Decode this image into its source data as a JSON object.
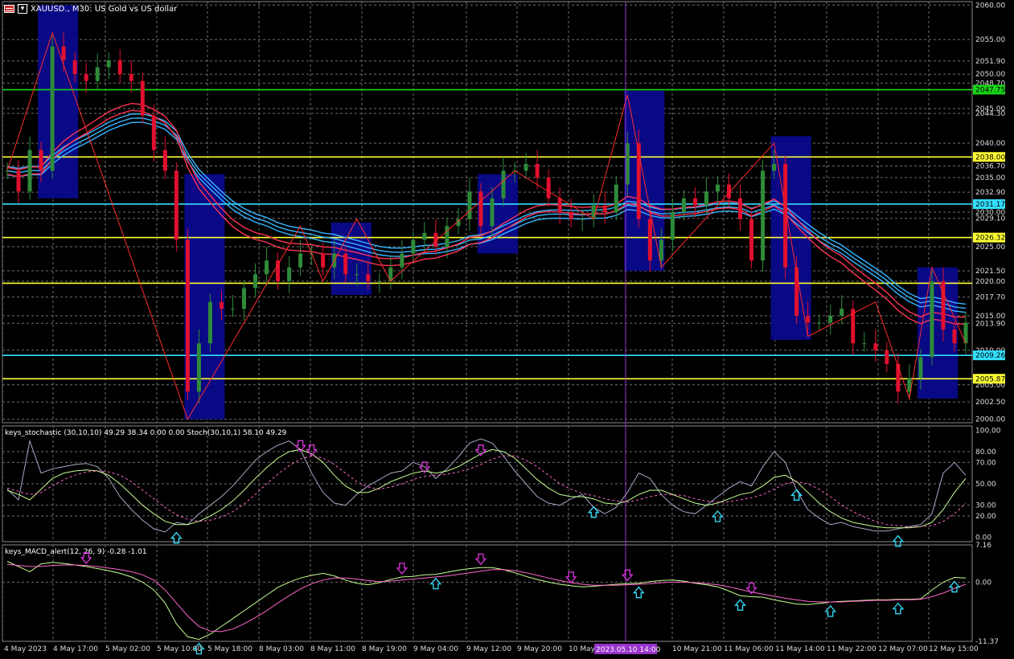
{
  "chart_title": "XAUUSD., M30:  US Gold vs US dollar",
  "colors": {
    "background": "#000000",
    "grid": "#6f6f6f",
    "bull": "#2e8b3a",
    "bear": "#e0102e",
    "zigzag": "#ff2a2a",
    "zone": "#0a0a8c",
    "ribbon_blue": "#37b6ff",
    "ribbon_red": "#ff3355",
    "level_green": "#19d419",
    "level_yellow": "#ffff33",
    "level_cyan": "#33e0ff",
    "cursor": "#9933cc",
    "up_arrow": "#33e0ff",
    "down_arrow": "#dd33dd"
  },
  "chart_data": [
    {
      "type": "candlestick",
      "symbol": "XAUUSD.",
      "timeframe": "M30",
      "description": "US Gold vs US dollar",
      "ylim": [
        1999.5,
        2060.5
      ],
      "y_ticks": [
        "2060.00",
        "2055.00",
        "2051.90",
        "2050.00",
        "2048.70",
        "2045.00",
        "2044.30",
        "2040.00",
        "2038.00",
        "2036.70",
        "2035.00",
        "2032.90",
        "2030.00",
        "2029.10",
        "2025.00",
        "2021.50",
        "2020.00",
        "2017.70",
        "2015.00",
        "2013.90",
        "2010.00",
        "2009.26",
        "2005.00",
        "2002.50",
        "2000.00"
      ],
      "x_ticks": [
        "4 May 2023",
        "4 May 17:00",
        "5 May 02:00",
        "5 May 10:00",
        "5 May 18:00",
        "8 May 03:00",
        "8 May 11:00",
        "8 May 19:00",
        "9 May 04:00",
        "9 May 12:00",
        "9 May 20:00",
        "10 May",
        "10 May 21:00",
        "11 May 06:00",
        "11 May 14:00",
        "11 May 22:00",
        "12 May 07:00",
        "12 May 15:00"
      ],
      "cursor_label": "2023.05.10 14:00",
      "horizontal_levels": [
        {
          "price": 2047.75,
          "label": "2047.75",
          "color": "green"
        },
        {
          "price": 2038.0,
          "label": "2038.00",
          "color": "yellow"
        },
        {
          "price": 2031.17,
          "label": "2031.17",
          "color": "cyan"
        },
        {
          "price": 2026.32,
          "label": "2026.32",
          "color": "yellow"
        },
        {
          "price": 2019.7,
          "label": "",
          "color": "yellow"
        },
        {
          "price": 2009.26,
          "label": "2009.26",
          "color": "cyan"
        },
        {
          "price": 2005.87,
          "label": "2005.87",
          "color": "yellow"
        }
      ],
      "zones": [
        {
          "i0": 3,
          "i1": 6,
          "high": 2060.0,
          "low": 2032.0
        },
        {
          "i0": 16,
          "i1": 19,
          "high": 2035.5,
          "low": 2000.0
        },
        {
          "i0": 29,
          "i1": 32,
          "high": 2028.5,
          "low": 2018.0
        },
        {
          "i0": 42,
          "i1": 45,
          "high": 2035.5,
          "low": 2024.0
        },
        {
          "i0": 55,
          "i1": 58,
          "high": 2047.6,
          "low": 2021.5
        },
        {
          "i0": 68,
          "i1": 71,
          "high": 2041.0,
          "low": 2011.5
        },
        {
          "i0": 81,
          "i1": 84,
          "high": 2022.0,
          "low": 2003.0
        }
      ],
      "closes": [
        2036,
        2033,
        2039,
        2036,
        2054,
        2052,
        2050,
        2049,
        2051,
        2052,
        2050,
        2049,
        2044,
        2039,
        2036,
        2026,
        2004,
        2011,
        2017,
        2016,
        2016,
        2019,
        2021,
        2023,
        2020,
        2022,
        2024,
        2024,
        2022,
        2024,
        2021,
        2021,
        2020,
        2020,
        2022,
        2024,
        2026,
        2027,
        2025,
        2028,
        2029,
        2033,
        2028,
        2032,
        2036,
        2036,
        2037,
        2035,
        2032,
        2030,
        2029,
        2029,
        2031,
        2030,
        2034,
        2040,
        2029,
        2023,
        2026,
        2030,
        2032,
        2031,
        2033,
        2034,
        2032,
        2029,
        2023,
        2036,
        2037,
        2022,
        2015,
        2014,
        2014,
        2015,
        2016,
        2011,
        2011,
        2010,
        2008,
        2004,
        2006,
        2009,
        2020,
        2013,
        2011,
        2014
      ]
    },
    {
      "type": "line",
      "title": "keys_stochastic (30,10,10) 49.29 38.34 0.00 0.00 Stoch(30,10,1) 58.10 49.29",
      "ylim": [
        0,
        100
      ],
      "y_ticks": [
        "100.00",
        "80.00",
        "70.00",
        "50.00",
        "30.00",
        "20.00",
        "0.00"
      ],
      "levels": [
        80,
        70,
        50,
        30,
        20
      ],
      "fast": [
        45,
        35,
        90,
        60,
        64,
        66,
        68,
        69,
        66,
        55,
        38,
        26,
        16,
        8,
        5,
        14,
        12,
        22,
        30,
        38,
        48,
        60,
        72,
        80,
        86,
        90,
        82,
        60,
        42,
        32,
        30,
        40,
        48,
        54,
        60,
        62,
        70,
        66,
        55,
        64,
        75,
        88,
        92,
        88,
        76,
        62,
        50,
        38,
        32,
        30,
        36,
        40,
        28,
        22,
        28,
        42,
        60,
        55,
        40,
        30,
        24,
        22,
        30,
        38,
        46,
        52,
        48,
        66,
        80,
        70,
        44,
        26,
        18,
        12,
        14,
        10,
        8,
        6,
        6,
        8,
        10,
        12,
        22,
        60,
        70,
        58
      ],
      "main": [
        44,
        40,
        35,
        45,
        55,
        60,
        62,
        63,
        62,
        58,
        50,
        40,
        30,
        22,
        15,
        12,
        12,
        15,
        20,
        26,
        34,
        44,
        55,
        65,
        74,
        80,
        82,
        78,
        70,
        58,
        48,
        42,
        42,
        46,
        52,
        56,
        60,
        62,
        60,
        62,
        66,
        72,
        78,
        82,
        80,
        74,
        64,
        54,
        46,
        40,
        38,
        38,
        36,
        32,
        31,
        34,
        40,
        44,
        44,
        40,
        36,
        32,
        30,
        32,
        36,
        40,
        42,
        48,
        56,
        58,
        52,
        42,
        32,
        24,
        18,
        14,
        12,
        10,
        9,
        9,
        9,
        10,
        14,
        26,
        42,
        55
      ],
      "signal": [
        46,
        43,
        40,
        42,
        48,
        54,
        58,
        61,
        62,
        61,
        58,
        52,
        44,
        36,
        28,
        21,
        17,
        15,
        16,
        19,
        24,
        31,
        40,
        50,
        59,
        67,
        73,
        76,
        74,
        68,
        60,
        52,
        47,
        45,
        47,
        50,
        54,
        57,
        58,
        59,
        61,
        64,
        68,
        73,
        76,
        76,
        72,
        66,
        58,
        50,
        45,
        41,
        39,
        36,
        34,
        33,
        35,
        38,
        40,
        40,
        39,
        36,
        34,
        33,
        33,
        35,
        37,
        40,
        45,
        50,
        52,
        50,
        45,
        38,
        30,
        24,
        19,
        15,
        12,
        11,
        10,
        10,
        11,
        15,
        22,
        32
      ],
      "down_arrow_bars": [
        26,
        27,
        37,
        42
      ],
      "up_arrow_bars": [
        15,
        52,
        63,
        70,
        79
      ]
    },
    {
      "type": "line",
      "title": "keys_MACD_alert(12, 26, 9) -0.28 -1.01",
      "ylim": [
        -11.37,
        7.16
      ],
      "y_ticks": [
        "7.16",
        "0.00",
        "-11.37"
      ],
      "macd": [
        4,
        3,
        2,
        3.5,
        3.8,
        3.6,
        3.3,
        3,
        2.6,
        2.2,
        1.7,
        1,
        0,
        -1.5,
        -4,
        -8,
        -10.5,
        -11,
        -10,
        -8.5,
        -7,
        -5.5,
        -4,
        -2.5,
        -1,
        0,
        0.8,
        1.3,
        1.7,
        1.2,
        0.4,
        -0.2,
        -0.5,
        -0.1,
        0.5,
        1,
        1.1,
        1.4,
        1.5,
        1.9,
        2.3,
        2.6,
        2.8,
        2.8,
        2.4,
        1.8,
        1.1,
        0.5,
        0,
        -0.4,
        -0.7,
        -0.9,
        -0.8,
        -0.6,
        -0.4,
        -0.3,
        -0.2,
        0.1,
        0.3,
        0.4,
        0.2,
        -0.2,
        -0.5,
        -0.9,
        -1.7,
        -2.6,
        -2.8,
        -2.9,
        -3.4,
        -3.8,
        -4.2,
        -4.3,
        -4.1,
        -3.8,
        -3.7,
        -3.6,
        -3.5,
        -3.4,
        -3.4,
        -3.3,
        -3.3,
        -3.2,
        -1.5,
        0,
        0.9,
        0.8
      ],
      "signal": [
        3.4,
        3.2,
        3,
        3,
        3.2,
        3.3,
        3.3,
        3.2,
        3,
        2.7,
        2.4,
        2,
        1.4,
        0.4,
        -1.5,
        -4,
        -6.5,
        -8.5,
        -9.4,
        -9.5,
        -9,
        -8,
        -6.8,
        -5.5,
        -4,
        -2.6,
        -1.3,
        -0.3,
        0.4,
        0.8,
        0.8,
        0.6,
        0.3,
        0.1,
        0.2,
        0.4,
        0.6,
        0.8,
        1,
        1.2,
        1.5,
        1.8,
        2.1,
        2.4,
        2.4,
        2.2,
        1.8,
        1.3,
        0.8,
        0.3,
        -0.1,
        -0.4,
        -0.6,
        -0.6,
        -0.6,
        -0.5,
        -0.4,
        -0.3,
        -0.1,
        0,
        0,
        -0.1,
        -0.3,
        -0.5,
        -0.9,
        -1.4,
        -1.9,
        -2.3,
        -2.7,
        -3.1,
        -3.4,
        -3.7,
        -3.8,
        -3.8,
        -3.8,
        -3.7,
        -3.6,
        -3.5,
        -3.5,
        -3.4,
        -3.4,
        -3.3,
        -2.8,
        -2.1,
        -1.2,
        -0.4
      ],
      "down_arrow_bars": [
        7,
        35,
        42,
        50,
        55,
        66
      ],
      "up_arrow_bars": [
        17,
        38,
        56,
        65,
        73,
        79,
        84
      ]
    }
  ]
}
